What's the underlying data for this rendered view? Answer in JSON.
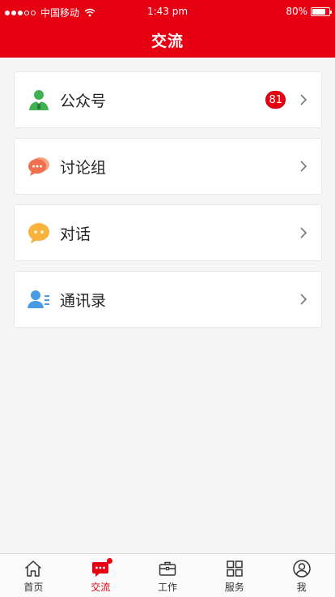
{
  "status_bar": {
    "carrier": "中国移动",
    "time": "1:43 pm",
    "battery": "80%",
    "battery_level": 0.8
  },
  "header": {
    "title": "交流"
  },
  "list": [
    {
      "label": "公众号",
      "badge": "81",
      "icon": "official-account-icon"
    },
    {
      "label": "讨论组",
      "icon": "discussion-group-icon"
    },
    {
      "label": "对话",
      "icon": "dialog-icon"
    },
    {
      "label": "通讯录",
      "icon": "contacts-icon"
    }
  ],
  "tabbar": {
    "items": [
      {
        "label": "首页",
        "icon": "home-icon"
      },
      {
        "label": "交流",
        "icon": "chat-icon",
        "active": true
      },
      {
        "label": "工作",
        "icon": "briefcase-icon"
      },
      {
        "label": "服务",
        "icon": "grid-icon"
      },
      {
        "label": "我",
        "icon": "profile-icon"
      }
    ]
  },
  "colors": {
    "brand": "#e60012",
    "background": "#f5f5f5"
  }
}
